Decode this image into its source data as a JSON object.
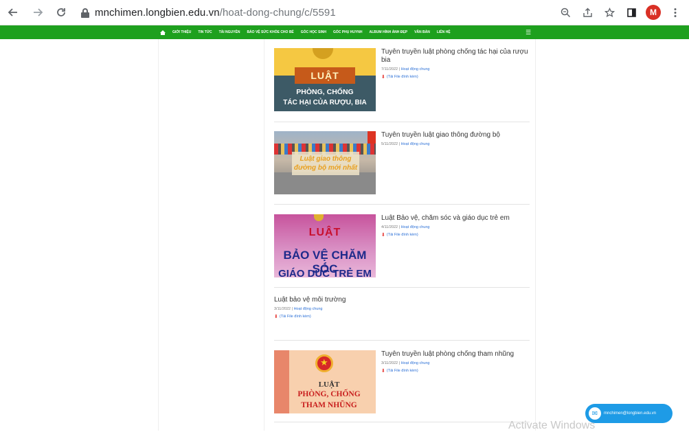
{
  "browser": {
    "url_domain": "mnchimen.longbien.edu.vn",
    "url_path": "/hoat-dong-chung/c/5591",
    "profile_initial": "M",
    "icons": [
      "back-arrow-icon",
      "forward-arrow-icon",
      "reload-icon",
      "lock-icon",
      "zoom-icon",
      "share-icon",
      "star-icon",
      "sidepanel-icon",
      "menu-dots-icon"
    ]
  },
  "sitenav": {
    "items": [
      "GIỚI THIỆU",
      "TIN TỨC",
      "TÀI NGUYÊN",
      "BẢO VỆ SỨC KHỎE CHO BÉ",
      "GÓC HỌC SINH",
      "GÓC PHỤ HUYNH",
      "ALBUM HÌNH ẢNH ĐẸP",
      "VĂN BẢN",
      "LIÊN HỆ"
    ],
    "menu_symbol": "☰"
  },
  "posts": [
    {
      "title": "Tuyên truyền luật phòng chống tác hại của rượu bia",
      "date": "7/11/2022",
      "category": "Hoạt động chung",
      "attachment": "(Tải File đính kèm)",
      "thumb": {
        "luat": "LUẬT",
        "line2": "PHÒNG, CHỐNG",
        "line3": "TÁC HẠI CỦA RƯỢU, BIA"
      }
    },
    {
      "title": "Tuyên truyền luật giao thông đường bộ",
      "date": "5/11/2022",
      "category": "Hoạt động chung",
      "thumb": {
        "line1": "Luật giao thông",
        "line2": "đường bộ mới nhất"
      }
    },
    {
      "title": "Luật Bảo vệ, chăm sóc và giáo dục trẻ em",
      "date": "4/11/2022",
      "category": "Hoạt động chung",
      "attachment": "(Tải File đính kèm)",
      "thumb": {
        "luat": "LUẬT",
        "line2": "BẢO VỆ CHĂM SÓC",
        "amp": "&",
        "line3": "GIÁO DỤC TRẺ EM"
      }
    },
    {
      "title": "Luật bảo vệ môi trường",
      "date": "3/11/2022",
      "category": "Hoạt động chung",
      "attachment": "(Tải File đính kèm)"
    },
    {
      "title": "Tuyên truyền luật phòng chống tham nhũng",
      "date": "3/11/2022",
      "category": "Hoạt động chung",
      "attachment": "(Tải File đính kèm)",
      "thumb": {
        "luat": "LUẬT",
        "line2": "PHÒNG, CHỐNG",
        "line3": "THAM NHŨNG"
      }
    }
  ],
  "meta_separator": "|",
  "chat": {
    "email": "mnchimen@longbien.edu.vn"
  },
  "watermark": "Activate Windows",
  "colors": {
    "nav_green": "#1ea01e",
    "link_blue": "#2a6fd6",
    "chat_blue": "#1e9be6"
  }
}
